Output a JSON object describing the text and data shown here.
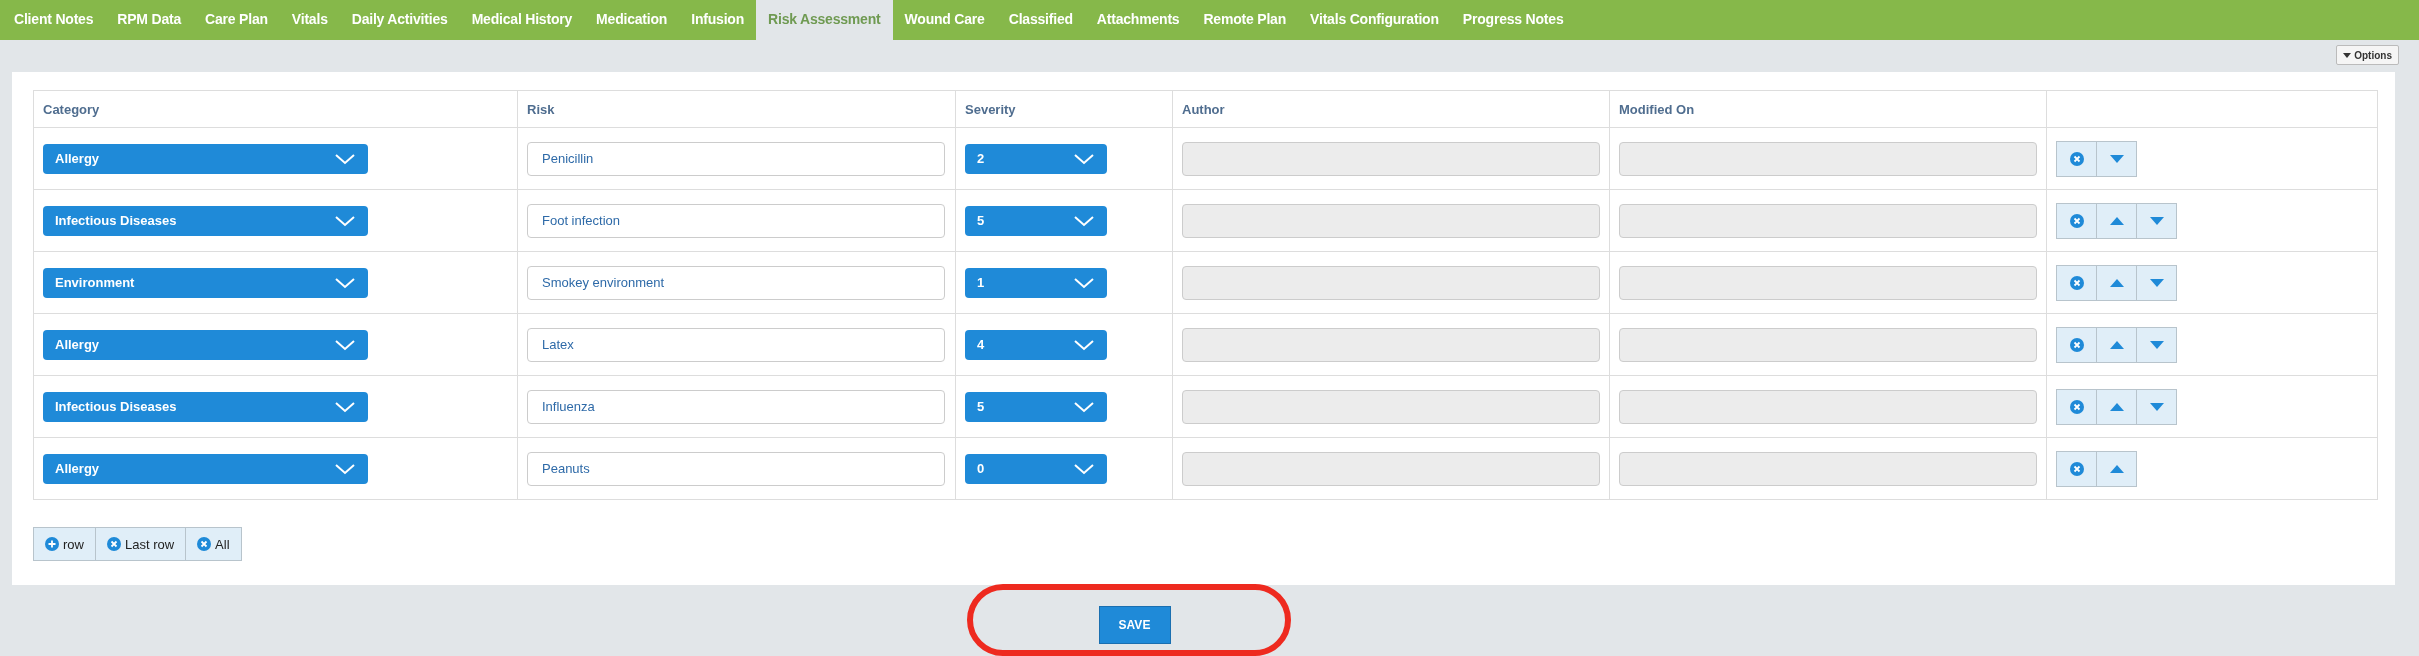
{
  "tabs": [
    {
      "label": "Client Notes",
      "selected": false
    },
    {
      "label": "RPM Data",
      "selected": false
    },
    {
      "label": "Care Plan",
      "selected": false
    },
    {
      "label": "Vitals",
      "selected": false
    },
    {
      "label": "Daily Activities",
      "selected": false
    },
    {
      "label": "Medical History",
      "selected": false
    },
    {
      "label": "Medication",
      "selected": false
    },
    {
      "label": "Infusion",
      "selected": false
    },
    {
      "label": "Risk Assessment",
      "selected": true
    },
    {
      "label": "Wound Care",
      "selected": false
    },
    {
      "label": "Classified",
      "selected": false
    },
    {
      "label": "Attachments",
      "selected": false
    },
    {
      "label": "Remote Plan",
      "selected": false
    },
    {
      "label": "Vitals Configuration",
      "selected": false
    },
    {
      "label": "Progress Notes",
      "selected": false
    }
  ],
  "options_button": {
    "label": "Options"
  },
  "table": {
    "columns": [
      "Category",
      "Risk",
      "Severity",
      "Author",
      "Modified On"
    ],
    "rows": [
      {
        "category": "Allergy",
        "risk": "Penicillin",
        "severity": "2",
        "can_move_up": false,
        "can_move_down": true
      },
      {
        "category": "Infectious Diseases",
        "risk": "Foot infection",
        "severity": "5",
        "can_move_up": true,
        "can_move_down": true
      },
      {
        "category": "Environment",
        "risk": "Smokey environment",
        "severity": "1",
        "can_move_up": true,
        "can_move_down": true
      },
      {
        "category": "Allergy",
        "risk": "Latex",
        "severity": "4",
        "can_move_up": true,
        "can_move_down": true
      },
      {
        "category": "Infectious Diseases",
        "risk": "Influenza",
        "severity": "5",
        "can_move_up": true,
        "can_move_down": true
      },
      {
        "category": "Allergy",
        "risk": "Peanuts",
        "severity": "0",
        "can_move_up": true,
        "can_move_down": false
      }
    ]
  },
  "row_buttons": [
    {
      "kind": "add",
      "label": "row"
    },
    {
      "kind": "remove",
      "label": "Last row"
    },
    {
      "kind": "remove",
      "label": "All"
    }
  ],
  "save_button": {
    "label": "SAVE"
  }
}
